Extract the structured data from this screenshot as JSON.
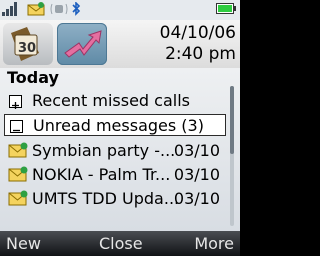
{
  "header": {
    "date": "04/10/06",
    "time": "2:40 pm"
  },
  "panel": {
    "title": "Today",
    "groups": [
      {
        "label": "Recent missed calls",
        "expanded": false
      },
      {
        "label": "Unread messages (3)",
        "expanded": true
      }
    ],
    "messages": [
      {
        "subject": "Symbian party -...",
        "date": "03/10"
      },
      {
        "subject": "NOKIA - Palm Tr...",
        "date": "03/10"
      },
      {
        "subject": "UMTS TDD Upda...",
        "date": "03/10"
      }
    ]
  },
  "softkeys": {
    "left": "New",
    "center": "Close",
    "right": "More"
  },
  "colors": {
    "status_bar": "#e6eaee",
    "softkey_bar": "#1a1c1f",
    "battery": "#2ecc40",
    "accent_tab": "#6f96b1"
  }
}
